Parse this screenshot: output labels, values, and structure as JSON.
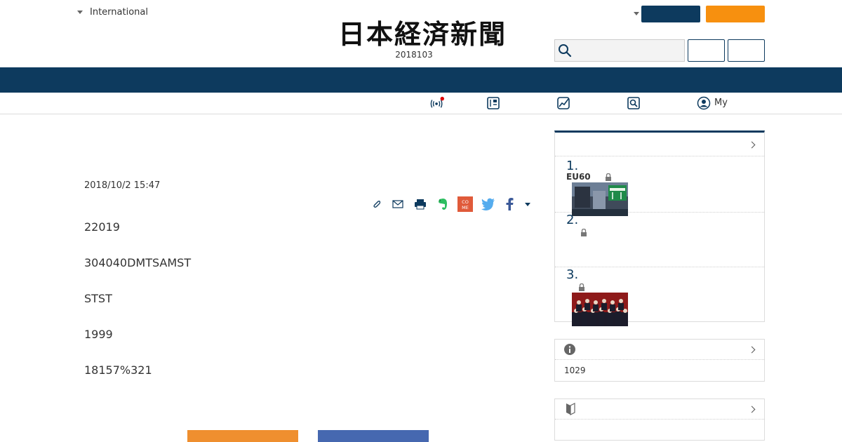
{
  "header": {
    "edition_label": "International",
    "logo_text": "日本経済新聞",
    "date_line": "2018103",
    "search": {
      "placeholder": ""
    }
  },
  "subnav": {
    "my_label": "My",
    "icons": [
      "broadcast-icon",
      "paper-icon",
      "chart-icon",
      "search-doc-icon",
      "user-icon"
    ]
  },
  "article": {
    "date": "2018/10/2 15:47",
    "paragraphs": [
      "22019",
      "304040DMTSAMST",
      "STST",
      "1999",
      "18157%321"
    ],
    "share_icons": [
      "clip-icon",
      "mail-icon",
      "print-icon",
      "evernote-icon",
      "come-icon",
      "twitter-icon",
      "facebook-icon",
      "more-caret-icon"
    ],
    "come_label": "CO ME"
  },
  "sidebar": {
    "ranking": [
      {
        "num": "1.",
        "title": "EU60"
      },
      {
        "num": "2.",
        "title": ""
      },
      {
        "num": "3.",
        "title": ""
      }
    ],
    "info_text": "1029"
  },
  "colors": {
    "navy": "#0d3a5e",
    "orange": "#f7900f",
    "facebook_blue": "#4668b0",
    "social_orange": "#ef8f2f"
  }
}
